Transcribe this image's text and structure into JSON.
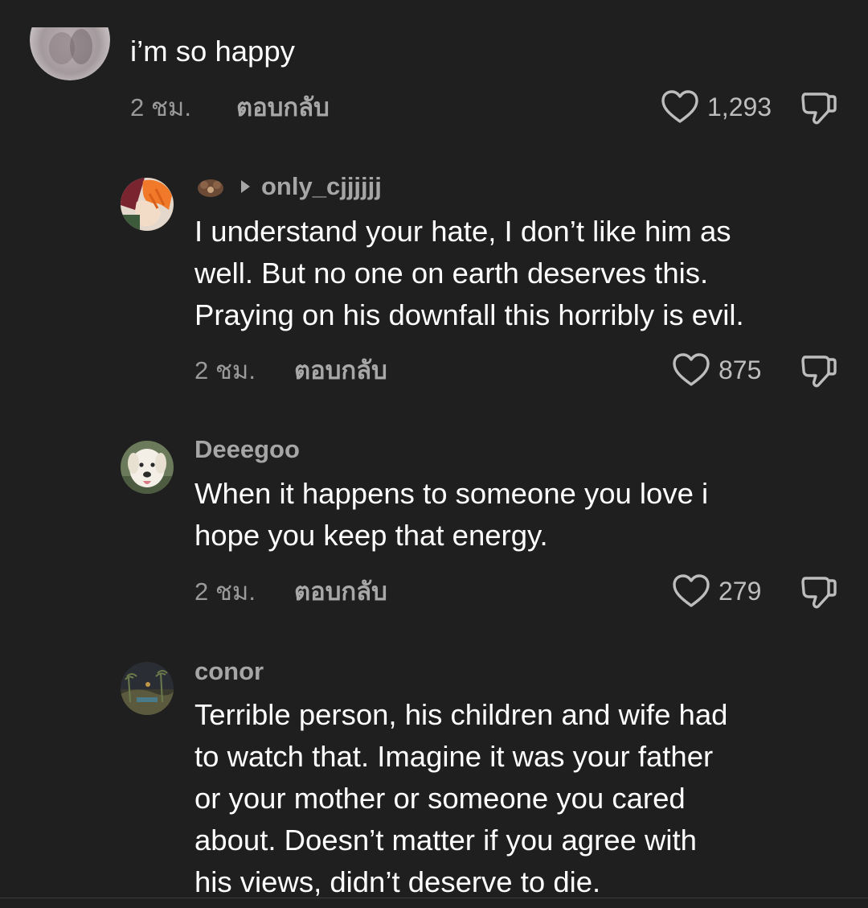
{
  "comments": [
    {
      "text": "i’m so happy",
      "time": "2 ชม.",
      "reply_label": "ตอบกลับ",
      "likes": "1,293"
    },
    {
      "username": "only_cjjjjjj",
      "text": "I understand your hate, I don’t like him as\nwell. But no one on earth deserves this.\nPraying on his downfall this horribly is evil.",
      "time": "2 ชม.",
      "reply_label": "ตอบกลับ",
      "likes": "875"
    },
    {
      "username": "Deeegoo",
      "text": "When it happens to someone you love i\nhope you keep that energy.",
      "time": "2 ชม.",
      "reply_label": "ตอบกลับ",
      "likes": "279"
    },
    {
      "username": "conor",
      "text": "Terrible person, his children and wife had\nto watch that. Imagine it was your father\nor your mother or someone you cared\nabout. Doesn’t matter if you agree with\nhis views, didn’t deserve to die."
    }
  ],
  "icons": {
    "like": "heart-outline-icon",
    "dislike": "thumbs-down-outline-icon",
    "reply_to": "caret-right-icon"
  },
  "colors": {
    "background": "#1f1f1f",
    "text": "#ffffff",
    "muted": "#9a9a9a"
  }
}
